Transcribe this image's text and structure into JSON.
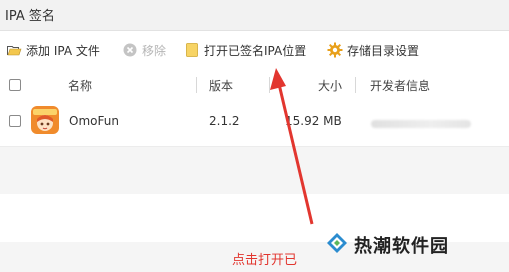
{
  "window": {
    "title": "IPA 签名"
  },
  "toolbar": {
    "add_label": "添加 IPA 文件",
    "remove_label": "移除",
    "open_label": "打开已签名IPA位置",
    "settings_label": "存储目录设置"
  },
  "table": {
    "columns": [
      "名称",
      "版本",
      "大小",
      "开发者信息"
    ],
    "rows": [
      {
        "name": "OmoFun",
        "version": "2.1.2",
        "size": "15.92 MB",
        "developer": ""
      }
    ]
  },
  "annotation": {
    "text": "点击打开已"
  },
  "watermark": {
    "text": "热潮软件园"
  },
  "colors": {
    "annotation": "#e2362f",
    "folder": "#f3c74e",
    "gear": "#e8a01b"
  }
}
